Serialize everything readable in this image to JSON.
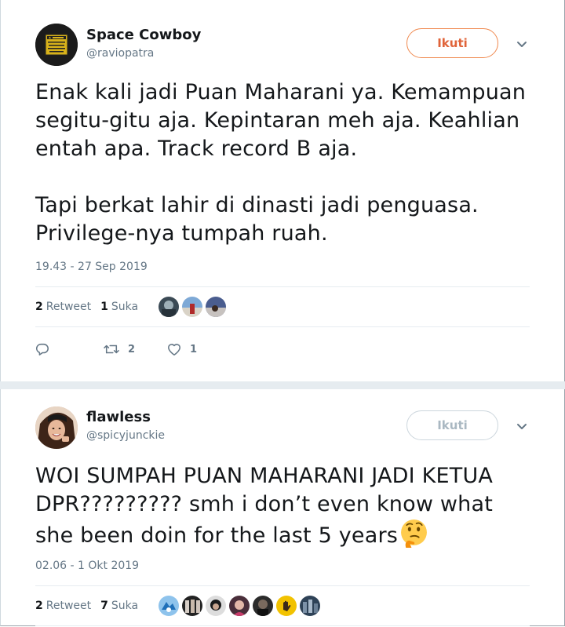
{
  "tweets": [
    {
      "display_name": "Space Cowboy",
      "handle": "@raviopatra",
      "follow_label": "Ikuti",
      "text": "Enak kali jadi Puan Maharani ya. Kemampuan segitu-gitu aja. Kepintaran meh aja. Keahlian entah apa. Track record B aja.\n\nTapi berkat lahir di dinasti jadi penguasa. Privilege-nya tumpah ruah.",
      "timestamp": "19.43 - 27 Sep 2019",
      "retweet_count": "2",
      "retweet_label": "Retweet",
      "like_count": "1",
      "like_label": "Suka",
      "action_retweet_count": "2",
      "action_like_count": "1",
      "follow_color": "#e0643a",
      "avatar_icon": "warning-sign-avatar"
    },
    {
      "display_name": "flawless",
      "handle": "@spicyjunckie",
      "follow_label": "Ikuti",
      "text": "WOI SUMPAH PUAN MAHARANI JADI KETUA DPR????????? smh i don’t even know what she been doin for the last 5 years",
      "emoji": "thinking-face",
      "timestamp": "02.06 - 1 Okt 2019",
      "retweet_count": "2",
      "retweet_label": "Retweet",
      "like_count": "7",
      "like_label": "Suka",
      "avatar_icon": "portrait-avatar"
    }
  ],
  "colors": {
    "text": "#14171a",
    "muted": "#657786",
    "border": "#e6ecf0",
    "follow_disabled": "#aab8c2"
  }
}
